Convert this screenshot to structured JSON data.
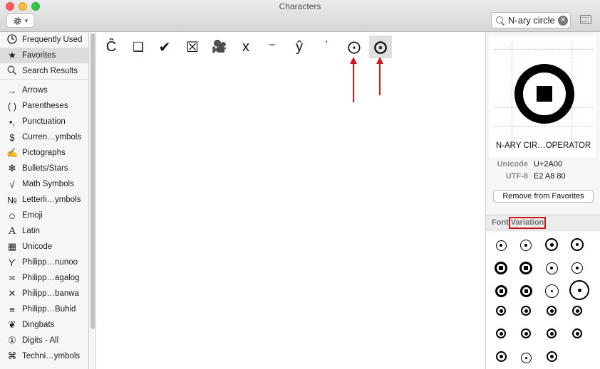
{
  "window": {
    "title": "Characters"
  },
  "toolbar": {
    "gear_icon": "gear-icon",
    "chevron": "▾"
  },
  "search": {
    "value": "N-ary circle",
    "clear_label": "✕"
  },
  "sidebar": {
    "items": [
      {
        "label": "Frequently Used",
        "icon": "⌚"
      },
      {
        "label": "Favorites",
        "icon": "★"
      },
      {
        "label": "Search Results",
        "icon": "🔍"
      },
      {
        "label": "Arrows",
        "icon": "→"
      },
      {
        "label": "Parentheses",
        "icon": "( )"
      },
      {
        "label": "Punctuation",
        "icon": "•,"
      },
      {
        "label": "Curren…ymbols",
        "icon": "$"
      },
      {
        "label": "Pictographs",
        "icon": "✍"
      },
      {
        "label": "Bullets/Stars",
        "icon": "✻"
      },
      {
        "label": "Math Symbols",
        "icon": "√"
      },
      {
        "label": "Letterli…ymbols",
        "icon": "№"
      },
      {
        "label": "Emoji",
        "icon": "☺"
      },
      {
        "label": "Latin",
        "icon": "A"
      },
      {
        "label": "Unicode",
        "icon": "▦"
      },
      {
        "label": "Philipp…nunoo",
        "icon": "ϒ"
      },
      {
        "label": "Philipp…agalog",
        "icon": "≍"
      },
      {
        "label": "Philipp…banwa",
        "icon": "✕"
      },
      {
        "label": "Philipp…Buhid",
        "icon": "≡"
      },
      {
        "label": "Dingbats",
        "icon": "❦"
      },
      {
        "label": "Digits - All",
        "icon": "①"
      },
      {
        "label": "Techni…ymbols",
        "icon": "⌘"
      }
    ]
  },
  "favorites_grid": [
    "Ĉ",
    "❑",
    "✔",
    "☒",
    "🎥",
    "x",
    "⁻",
    "ŷ",
    "ʾ",
    "⨀",
    "⨀"
  ],
  "details": {
    "name": "N-ARY CIR…OPERATOR",
    "unicode_label": "Unicode",
    "unicode_value": "U+2A00",
    "utf8_label": "UTF-8",
    "utf8_value": "E2 A8 80",
    "remove_button": "Remove from Favorites"
  },
  "font_variation": {
    "label_font": "Font",
    "label_variation": "Variation"
  }
}
